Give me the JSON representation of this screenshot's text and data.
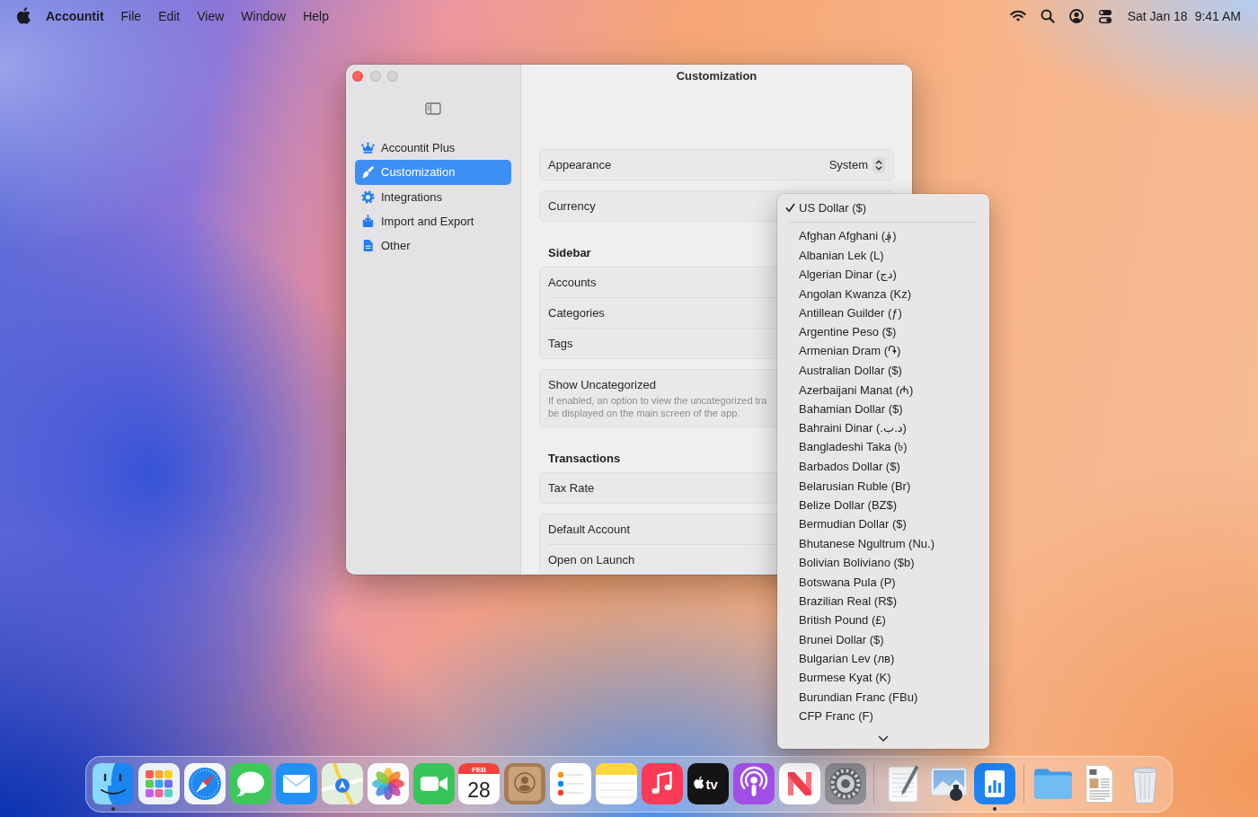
{
  "menu_bar": {
    "app_name": "Accountit",
    "menus": [
      "File",
      "Edit",
      "View",
      "Window",
      "Help"
    ],
    "date": "Sat Jan 18",
    "time": "9:41 AM"
  },
  "window": {
    "title": "Customization",
    "traffic_lights": [
      {
        "enabled": true
      },
      {
        "enabled": false
      },
      {
        "enabled": false
      }
    ],
    "sidebar": {
      "items": [
        {
          "label": "Accountit Plus",
          "selected": false
        },
        {
          "label": "Customization",
          "selected": true
        },
        {
          "label": "Integrations",
          "selected": false
        },
        {
          "label": "Import and Export",
          "selected": false
        },
        {
          "label": "Other",
          "selected": false
        }
      ]
    },
    "groups": [
      {
        "rows": [
          {
            "kind": "popup",
            "label": "Appearance",
            "value": "System"
          }
        ]
      },
      {
        "rows": [
          {
            "kind": "plain",
            "label": "Currency"
          }
        ]
      },
      {
        "heading": "Sidebar",
        "rows": [
          {
            "kind": "plain",
            "label": "Accounts"
          },
          {
            "kind": "plain",
            "label": "Categories"
          },
          {
            "kind": "plain",
            "label": "Tags"
          }
        ]
      },
      {
        "rows": [
          {
            "kind": "described",
            "label": "Show Uncategorized",
            "description": "If enabled, an option to view the uncategorized tra\nbe displayed on the main screen of the app."
          }
        ]
      },
      {
        "heading": "Transactions",
        "rows": [
          {
            "kind": "plain",
            "label": "Tax Rate"
          }
        ]
      },
      {
        "rows": [
          {
            "kind": "plain",
            "label": "Default Account"
          },
          {
            "kind": "plain",
            "label": "Open on Launch"
          }
        ]
      }
    ]
  },
  "currency_menu": {
    "sections": [
      {
        "items": [
          {
            "label": "US Dollar ($)",
            "selected": true
          }
        ]
      },
      {
        "items": [
          {
            "label": "Afghan Afghani (؋)",
            "selected": false
          },
          {
            "label": "Albanian Lek (L)",
            "selected": false
          },
          {
            "label": "Algerian Dinar (دج)",
            "selected": false
          },
          {
            "label": "Angolan Kwanza (Kz)",
            "selected": false
          },
          {
            "label": "Antillean Guilder (ƒ)",
            "selected": false
          },
          {
            "label": "Argentine Peso ($)",
            "selected": false
          },
          {
            "label": "Armenian Dram (֏)",
            "selected": false
          },
          {
            "label": "Australian Dollar ($)",
            "selected": false
          },
          {
            "label": "Azerbaijani Manat (₼)",
            "selected": false
          },
          {
            "label": "Bahamian Dollar ($)",
            "selected": false
          },
          {
            "label": "Bahraini Dinar (.د.ب)",
            "selected": false
          },
          {
            "label": "Bangladeshi Taka (৳)",
            "selected": false
          },
          {
            "label": "Barbados Dollar ($)",
            "selected": false
          },
          {
            "label": "Belarusian Ruble (Br)",
            "selected": false
          },
          {
            "label": "Belize Dollar (BZ$)",
            "selected": false
          },
          {
            "label": "Bermudian Dollar ($)",
            "selected": false
          },
          {
            "label": "Bhutanese Ngultrum (Nu.)",
            "selected": false
          },
          {
            "label": "Bolivian Boliviano ($b)",
            "selected": false
          },
          {
            "label": "Botswana Pula (P)",
            "selected": false
          },
          {
            "label": "Brazilian Real (R$)",
            "selected": false
          },
          {
            "label": "British Pound (£)",
            "selected": false
          },
          {
            "label": "Brunei Dollar ($)",
            "selected": false
          },
          {
            "label": "Bulgarian Lev (лв)",
            "selected": false
          },
          {
            "label": "Burmese Kyat (K)",
            "selected": false
          },
          {
            "label": "Burundian Franc (FBu)",
            "selected": false
          },
          {
            "label": "CFP Franc (F)",
            "selected": false
          }
        ]
      }
    ],
    "more_below": true
  },
  "dock": {
    "sections": [
      {
        "apps": [
          {
            "running": true
          },
          {
            "running": false
          },
          {
            "running": false
          },
          {
            "running": false
          },
          {
            "running": false
          },
          {
            "running": false
          },
          {
            "running": false
          },
          {
            "running": false
          },
          {
            "running": false,
            "month": "FEB",
            "day": "28"
          },
          {
            "running": false
          },
          {
            "running": false
          },
          {
            "running": false
          },
          {
            "running": false
          },
          {
            "running": false,
            "label": "tv"
          },
          {
            "running": false
          },
          {
            "running": false
          },
          {
            "running": false
          }
        ]
      },
      {
        "apps": [
          {
            "running": false
          },
          {
            "running": false
          },
          {
            "running": true
          }
        ]
      },
      {
        "apps": [
          {
            "running": false
          },
          {
            "running": false
          },
          {
            "running": false
          }
        ]
      }
    ]
  }
}
